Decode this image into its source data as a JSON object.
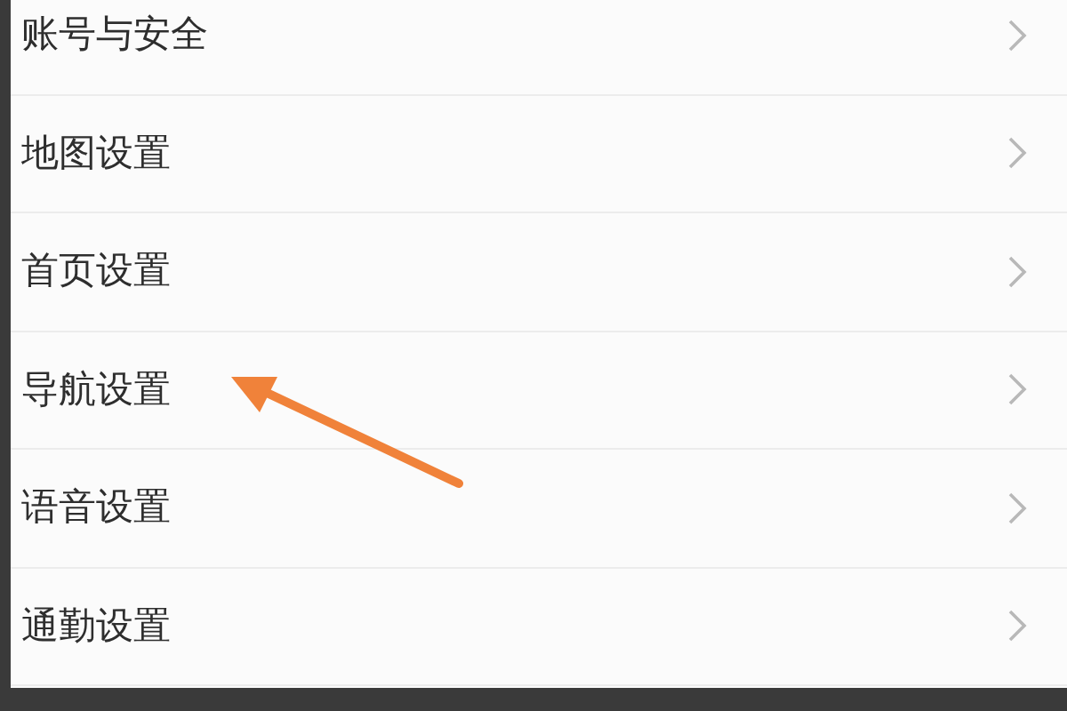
{
  "settings_list": [
    {
      "label": "账号与安全"
    },
    {
      "label": "地图设置"
    },
    {
      "label": "首页设置"
    },
    {
      "label": "导航设置"
    },
    {
      "label": "语音设置"
    },
    {
      "label": "通勤设置"
    }
  ]
}
